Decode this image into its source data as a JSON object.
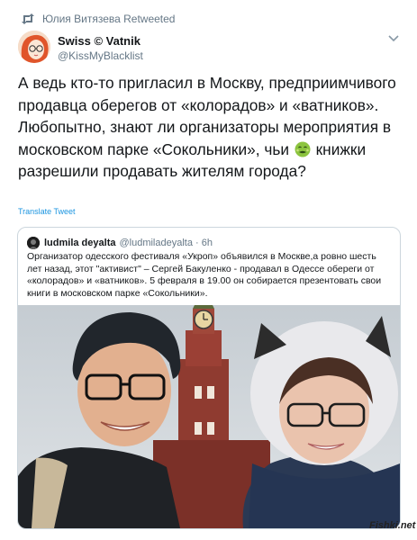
{
  "retweet": {
    "text": "Юлия Витязева Retweeted"
  },
  "author": {
    "name": "Swiss © Vatnik",
    "handle": "@KissMyBlacklist"
  },
  "tweet": {
    "text_before_emoji": "А ведь кто-то пригласил в Москву, предприимчивого продавца оберегов от «колорадов» и «ватников». Любопытно, знают ли организаторы мероприятия в московском парке «Сокольники», чьи",
    "emoji_name": "nauseated-face-icon",
    "text_after_emoji": "книжки разрешили продавать жителям города?"
  },
  "translate_label": "Translate Tweet",
  "quoted": {
    "name": "ludmila deyalta",
    "handle": "@ludmiladeyalta · 6h",
    "text": "Организатор одесского фестиваля «Укроп» объявился в Москве,а ровно шесть лет назад, этот \"активист\" – Сергей Бакуленко - продавал в Одессе обереги от «колорадов» и «ватников». 5 февраля в 19.00  он собирается презентовать свои книги в московском парке «Сокольники»."
  },
  "watermark": "Fishki.net",
  "colors": {
    "link": "#1b95e0",
    "muted": "#657786",
    "border": "#ccd6dd",
    "text": "#14171a"
  }
}
